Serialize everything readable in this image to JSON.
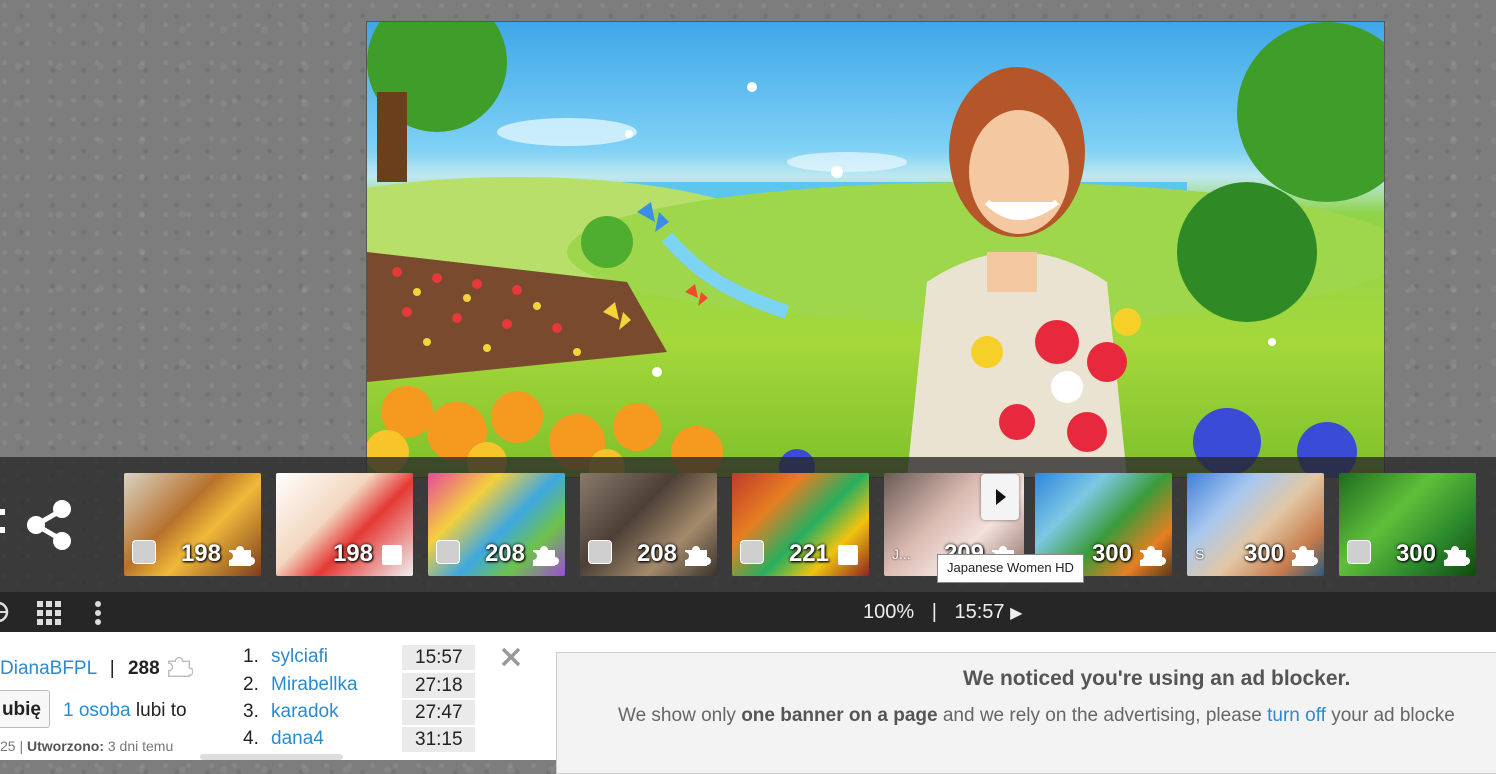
{
  "thumbnails": [
    {
      "count": "198",
      "badge": "puzzle",
      "has_avatar": true,
      "subject": "breakfast-crepes-juice"
    },
    {
      "count": "198",
      "badge": "square",
      "has_avatar": false,
      "subject": "baby-santa-hat"
    },
    {
      "count": "208",
      "badge": "puzzle",
      "has_avatar": true,
      "subject": "colorful-owl-pattern"
    },
    {
      "count": "208",
      "badge": "puzzle",
      "has_avatar": true,
      "subject": "industrial-buildings"
    },
    {
      "count": "221",
      "badge": "square",
      "has_avatar": true,
      "subject": "vegetable-market"
    },
    {
      "count": "209",
      "badge": "puzzle",
      "prefix": "J...",
      "subject": "japanese-women"
    },
    {
      "count": "300",
      "badge": "puzzle",
      "has_avatar": false,
      "subject": "fruit-vendor"
    },
    {
      "count": "300",
      "badge": "puzzle",
      "prefix": "S",
      "subject": "canal-town"
    },
    {
      "count": "300",
      "badge": "puzzle",
      "has_avatar": true,
      "subject": "basil-leaves"
    }
  ],
  "tooltip": "Japanese Women HD",
  "controls": {
    "zoom": "100%",
    "separator": "|",
    "timer": "15:57",
    "play_glyph": "▶"
  },
  "author": {
    "name": "DianaBFPL",
    "separator": "|",
    "pieces": "288"
  },
  "like": {
    "button_label": "ubię",
    "count_link": "1 osoba",
    "suffix": "lubi to"
  },
  "created": {
    "prefix": "25 | ",
    "label": "Utworzono:",
    "value": "3 dni temu"
  },
  "ranking": [
    {
      "pos": "1.",
      "name": "sylciafi",
      "time": "15:57"
    },
    {
      "pos": "2.",
      "name": "Mirabellka",
      "time": "27:18"
    },
    {
      "pos": "3.",
      "name": "karadok",
      "time": "27:47"
    },
    {
      "pos": "4.",
      "name": "dana4",
      "time": "31:15"
    }
  ],
  "adblock": {
    "headline": "We noticed you're using an ad blocker.",
    "body_start": "We show only ",
    "body_bold": "one banner on a page",
    "body_middle": " and we rely on the advertising, please ",
    "body_link": "turn off",
    "body_end": " your ad blocke"
  },
  "icons": {
    "share": "share-icon",
    "grid": "grid-icon",
    "more": "more-vertical-icon",
    "close": "close-icon",
    "next": "chevron-right-icon",
    "piece": "puzzle-piece-icon"
  }
}
